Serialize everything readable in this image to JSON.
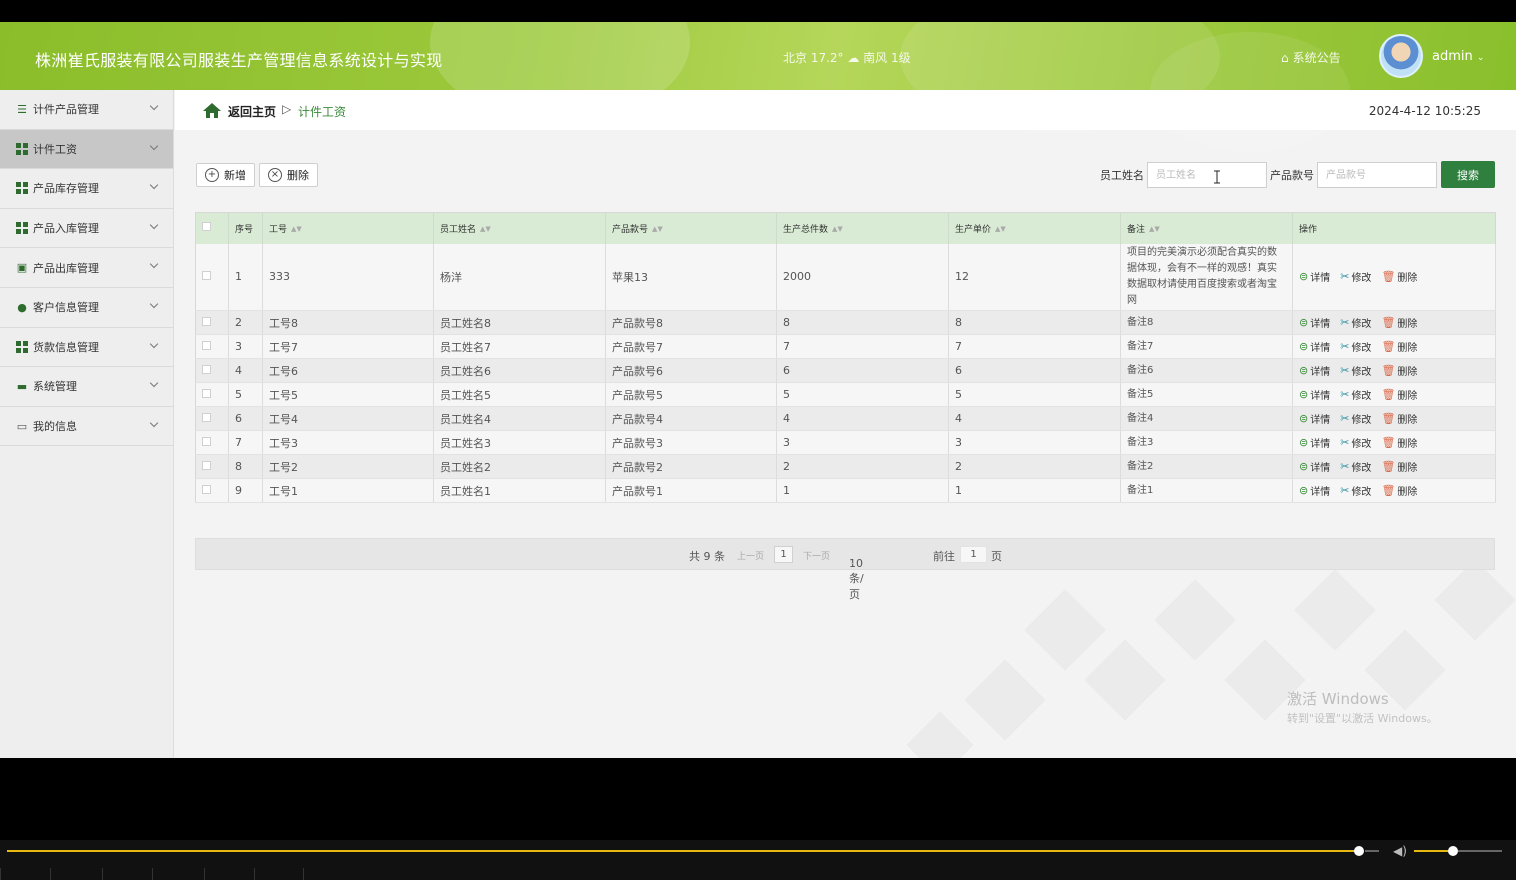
{
  "header": {
    "app_title": "株洲崔氏服装有限公司服装生产管理信息系统设计与实现",
    "weather": "北京  17.2°  ☁  南风  1级",
    "notice": "系统公告",
    "username": "admin",
    "brand_color": "#9cc93c"
  },
  "sidebar": {
    "items": [
      {
        "label": "计件产品管理",
        "icon": "list-icon"
      },
      {
        "label": "计件工资",
        "icon": "grid-icon"
      },
      {
        "label": "产品库存管理",
        "icon": "grid-icon"
      },
      {
        "label": "产品入库管理",
        "icon": "grid-icon"
      },
      {
        "label": "产品出库管理",
        "icon": "clipboard-icon"
      },
      {
        "label": "客户信息管理",
        "icon": "pin-icon"
      },
      {
        "label": "货款信息管理",
        "icon": "grid-icon"
      },
      {
        "label": "系统管理",
        "icon": "flag-icon"
      },
      {
        "label": "我的信息",
        "icon": "card-icon"
      }
    ],
    "active_index": 1
  },
  "breadcrumb": {
    "home": "返回主页",
    "separator": "▷",
    "current": "计件工资"
  },
  "clock": "2024-4-12 10:5:25",
  "toolbar": {
    "add_label": "新增",
    "delete_label": "删除",
    "employee_name_label": "员工姓名",
    "employee_name_placeholder": "员工姓名",
    "product_no_label": "产品款号",
    "product_no_placeholder": "产品款号",
    "search_label": "搜索"
  },
  "table": {
    "columns": [
      "序号",
      "工号",
      "员工姓名",
      "产品款号",
      "生产总件数",
      "生产单价",
      "备注",
      "操作"
    ],
    "actions": {
      "view": "详情",
      "edit": "修改",
      "delete": "删除"
    },
    "rows": [
      {
        "no": "1",
        "emp_id": "333",
        "name": "杨洋",
        "product": "苹果13",
        "qty": "2000",
        "price": "12",
        "remark": "项目的完美演示必须配合真实的数据体现，会有不一样的观感！真实数据取材请使用百度搜索或者淘宝网"
      },
      {
        "no": "2",
        "emp_id": "工号8",
        "name": "员工姓名8",
        "product": "产品款号8",
        "qty": "8",
        "price": "8",
        "remark": "备注8"
      },
      {
        "no": "3",
        "emp_id": "工号7",
        "name": "员工姓名7",
        "product": "产品款号7",
        "qty": "7",
        "price": "7",
        "remark": "备注7"
      },
      {
        "no": "4",
        "emp_id": "工号6",
        "name": "员工姓名6",
        "product": "产品款号6",
        "qty": "6",
        "price": "6",
        "remark": "备注6"
      },
      {
        "no": "5",
        "emp_id": "工号5",
        "name": "员工姓名5",
        "product": "产品款号5",
        "qty": "5",
        "price": "5",
        "remark": "备注5"
      },
      {
        "no": "6",
        "emp_id": "工号4",
        "name": "员工姓名4",
        "product": "产品款号4",
        "qty": "4",
        "price": "4",
        "remark": "备注4"
      },
      {
        "no": "7",
        "emp_id": "工号3",
        "name": "员工姓名3",
        "product": "产品款号3",
        "qty": "3",
        "price": "3",
        "remark": "备注3"
      },
      {
        "no": "8",
        "emp_id": "工号2",
        "name": "员工姓名2",
        "product": "产品款号2",
        "qty": "2",
        "price": "2",
        "remark": "备注2"
      },
      {
        "no": "9",
        "emp_id": "工号1",
        "name": "员工姓名1",
        "product": "产品款号1",
        "qty": "1",
        "price": "1",
        "remark": "备注1"
      }
    ]
  },
  "pager": {
    "total": "共 9 条",
    "prev": "上一页",
    "page": "1",
    "next": "下一页",
    "page_size": "10条/页",
    "goto_label": "前往",
    "goto_value": "1",
    "goto_suffix": "页"
  },
  "watermark": {
    "line1": "激活 Windows",
    "line2": "转到\"设置\"以激活 Windows。"
  },
  "video": {
    "progress": 0.9,
    "volume": 0.45
  }
}
